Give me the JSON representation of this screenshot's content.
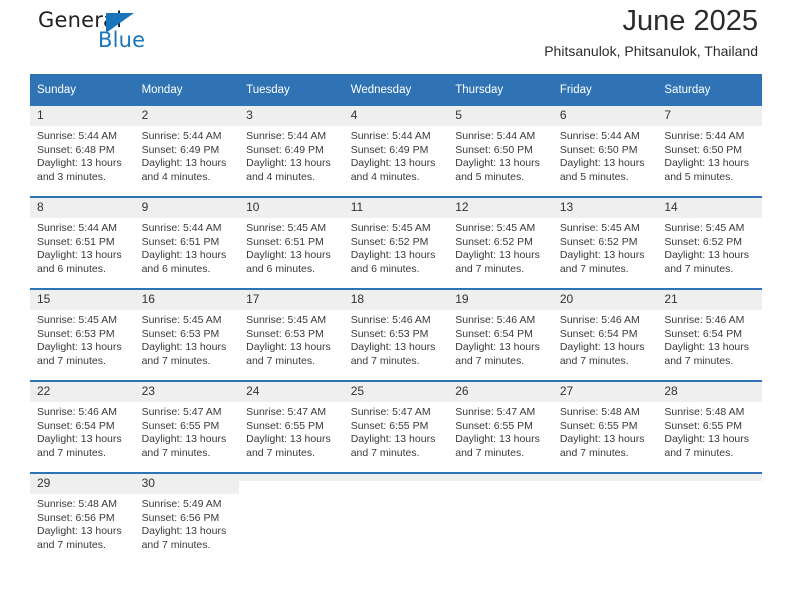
{
  "brand": {
    "name_top": "General",
    "name_bottom": "Blue",
    "triangle_color": "#1b75bb",
    "text_color": "#231f20"
  },
  "header": {
    "title": "June 2025",
    "subtitle": "Phitsanulok, Phitsanulok, Thailand",
    "accent_color": "#2f73b4",
    "daynum_band_color": "#efefef"
  },
  "weekdays": [
    "Sunday",
    "Monday",
    "Tuesday",
    "Wednesday",
    "Thursday",
    "Friday",
    "Saturday"
  ],
  "labels": {
    "sunrise": "Sunrise:",
    "sunset": "Sunset:",
    "daylight": "Daylight:"
  },
  "weeks": [
    [
      {
        "day": "1",
        "sunrise": "Sunrise: 5:44 AM",
        "sunset": "Sunset: 6:48 PM",
        "daylight": "Daylight: 13 hours and 3 minutes."
      },
      {
        "day": "2",
        "sunrise": "Sunrise: 5:44 AM",
        "sunset": "Sunset: 6:49 PM",
        "daylight": "Daylight: 13 hours and 4 minutes."
      },
      {
        "day": "3",
        "sunrise": "Sunrise: 5:44 AM",
        "sunset": "Sunset: 6:49 PM",
        "daylight": "Daylight: 13 hours and 4 minutes."
      },
      {
        "day": "4",
        "sunrise": "Sunrise: 5:44 AM",
        "sunset": "Sunset: 6:49 PM",
        "daylight": "Daylight: 13 hours and 4 minutes."
      },
      {
        "day": "5",
        "sunrise": "Sunrise: 5:44 AM",
        "sunset": "Sunset: 6:50 PM",
        "daylight": "Daylight: 13 hours and 5 minutes."
      },
      {
        "day": "6",
        "sunrise": "Sunrise: 5:44 AM",
        "sunset": "Sunset: 6:50 PM",
        "daylight": "Daylight: 13 hours and 5 minutes."
      },
      {
        "day": "7",
        "sunrise": "Sunrise: 5:44 AM",
        "sunset": "Sunset: 6:50 PM",
        "daylight": "Daylight: 13 hours and 5 minutes."
      }
    ],
    [
      {
        "day": "8",
        "sunrise": "Sunrise: 5:44 AM",
        "sunset": "Sunset: 6:51 PM",
        "daylight": "Daylight: 13 hours and 6 minutes."
      },
      {
        "day": "9",
        "sunrise": "Sunrise: 5:44 AM",
        "sunset": "Sunset: 6:51 PM",
        "daylight": "Daylight: 13 hours and 6 minutes."
      },
      {
        "day": "10",
        "sunrise": "Sunrise: 5:45 AM",
        "sunset": "Sunset: 6:51 PM",
        "daylight": "Daylight: 13 hours and 6 minutes."
      },
      {
        "day": "11",
        "sunrise": "Sunrise: 5:45 AM",
        "sunset": "Sunset: 6:52 PM",
        "daylight": "Daylight: 13 hours and 6 minutes."
      },
      {
        "day": "12",
        "sunrise": "Sunrise: 5:45 AM",
        "sunset": "Sunset: 6:52 PM",
        "daylight": "Daylight: 13 hours and 7 minutes."
      },
      {
        "day": "13",
        "sunrise": "Sunrise: 5:45 AM",
        "sunset": "Sunset: 6:52 PM",
        "daylight": "Daylight: 13 hours and 7 minutes."
      },
      {
        "day": "14",
        "sunrise": "Sunrise: 5:45 AM",
        "sunset": "Sunset: 6:52 PM",
        "daylight": "Daylight: 13 hours and 7 minutes."
      }
    ],
    [
      {
        "day": "15",
        "sunrise": "Sunrise: 5:45 AM",
        "sunset": "Sunset: 6:53 PM",
        "daylight": "Daylight: 13 hours and 7 minutes."
      },
      {
        "day": "16",
        "sunrise": "Sunrise: 5:45 AM",
        "sunset": "Sunset: 6:53 PM",
        "daylight": "Daylight: 13 hours and 7 minutes."
      },
      {
        "day": "17",
        "sunrise": "Sunrise: 5:45 AM",
        "sunset": "Sunset: 6:53 PM",
        "daylight": "Daylight: 13 hours and 7 minutes."
      },
      {
        "day": "18",
        "sunrise": "Sunrise: 5:46 AM",
        "sunset": "Sunset: 6:53 PM",
        "daylight": "Daylight: 13 hours and 7 minutes."
      },
      {
        "day": "19",
        "sunrise": "Sunrise: 5:46 AM",
        "sunset": "Sunset: 6:54 PM",
        "daylight": "Daylight: 13 hours and 7 minutes."
      },
      {
        "day": "20",
        "sunrise": "Sunrise: 5:46 AM",
        "sunset": "Sunset: 6:54 PM",
        "daylight": "Daylight: 13 hours and 7 minutes."
      },
      {
        "day": "21",
        "sunrise": "Sunrise: 5:46 AM",
        "sunset": "Sunset: 6:54 PM",
        "daylight": "Daylight: 13 hours and 7 minutes."
      }
    ],
    [
      {
        "day": "22",
        "sunrise": "Sunrise: 5:46 AM",
        "sunset": "Sunset: 6:54 PM",
        "daylight": "Daylight: 13 hours and 7 minutes."
      },
      {
        "day": "23",
        "sunrise": "Sunrise: 5:47 AM",
        "sunset": "Sunset: 6:55 PM",
        "daylight": "Daylight: 13 hours and 7 minutes."
      },
      {
        "day": "24",
        "sunrise": "Sunrise: 5:47 AM",
        "sunset": "Sunset: 6:55 PM",
        "daylight": "Daylight: 13 hours and 7 minutes."
      },
      {
        "day": "25",
        "sunrise": "Sunrise: 5:47 AM",
        "sunset": "Sunset: 6:55 PM",
        "daylight": "Daylight: 13 hours and 7 minutes."
      },
      {
        "day": "26",
        "sunrise": "Sunrise: 5:47 AM",
        "sunset": "Sunset: 6:55 PM",
        "daylight": "Daylight: 13 hours and 7 minutes."
      },
      {
        "day": "27",
        "sunrise": "Sunrise: 5:48 AM",
        "sunset": "Sunset: 6:55 PM",
        "daylight": "Daylight: 13 hours and 7 minutes."
      },
      {
        "day": "28",
        "sunrise": "Sunrise: 5:48 AM",
        "sunset": "Sunset: 6:55 PM",
        "daylight": "Daylight: 13 hours and 7 minutes."
      }
    ],
    [
      {
        "day": "29",
        "sunrise": "Sunrise: 5:48 AM",
        "sunset": "Sunset: 6:56 PM",
        "daylight": "Daylight: 13 hours and 7 minutes."
      },
      {
        "day": "30",
        "sunrise": "Sunrise: 5:49 AM",
        "sunset": "Sunset: 6:56 PM",
        "daylight": "Daylight: 13 hours and 7 minutes."
      },
      {
        "day": "",
        "sunrise": "",
        "sunset": "",
        "daylight": ""
      },
      {
        "day": "",
        "sunrise": "",
        "sunset": "",
        "daylight": ""
      },
      {
        "day": "",
        "sunrise": "",
        "sunset": "",
        "daylight": ""
      },
      {
        "day": "",
        "sunrise": "",
        "sunset": "",
        "daylight": ""
      },
      {
        "day": "",
        "sunrise": "",
        "sunset": "",
        "daylight": ""
      }
    ]
  ]
}
